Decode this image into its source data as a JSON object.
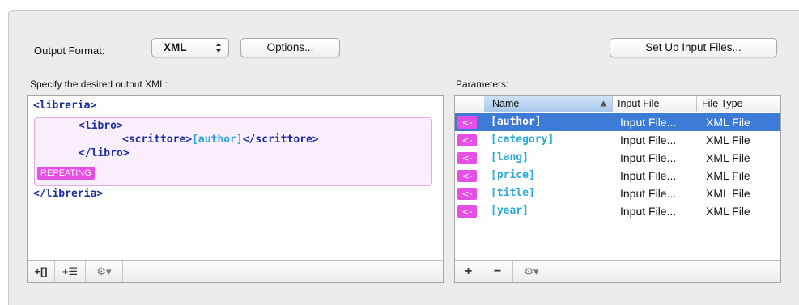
{
  "top_bar": {
    "output_format_label": "Output Format:",
    "output_format_value": "XML",
    "options_button": "Options...",
    "setup_button": "Set Up Input Files..."
  },
  "xml_panel": {
    "heading": "Specify the desired output XML:",
    "lines": {
      "root_open": "<libreria>",
      "child_open": "<libro>",
      "inner_open": "<scrittore>",
      "inner_param": "[author]",
      "inner_close": "</scrittore>",
      "child_close": "</libro>",
      "root_close": "</libreria>"
    },
    "repeating_badge": "REPEATING",
    "toolbar": {
      "add_placeholder": "+[]",
      "add_list": "+☰",
      "gear": "⚙▾"
    }
  },
  "params_panel": {
    "heading": "Parameters:",
    "columns": {
      "name": "Name",
      "input_file": "Input File",
      "file_type": "File Type"
    },
    "rows": [
      {
        "arrow": "<-",
        "name": "[author]",
        "input_file": "Input File...",
        "file_type": "XML File"
      },
      {
        "arrow": "<-",
        "name": "[category]",
        "input_file": "Input File...",
        "file_type": "XML File"
      },
      {
        "arrow": "<-",
        "name": "[lang]",
        "input_file": "Input File...",
        "file_type": "XML File"
      },
      {
        "arrow": "<-",
        "name": "[price]",
        "input_file": "Input File...",
        "file_type": "XML File"
      },
      {
        "arrow": "<-",
        "name": "[title]",
        "input_file": "Input File...",
        "file_type": "XML File"
      },
      {
        "arrow": "<-",
        "name": "[year]",
        "input_file": "Input File...",
        "file_type": "XML File"
      }
    ],
    "toolbar": {
      "add": "+",
      "remove": "−",
      "gear": "⚙▾"
    }
  },
  "colors": {
    "tag": "#1a2fa0",
    "param": "#2ca9d6",
    "repeat_accent": "#e64fe6",
    "selection": "#3b7bd6"
  },
  "icons": {
    "sort": "sort-ascending-icon",
    "stepper": "select-stepper-icon",
    "gear": "gear-icon"
  }
}
